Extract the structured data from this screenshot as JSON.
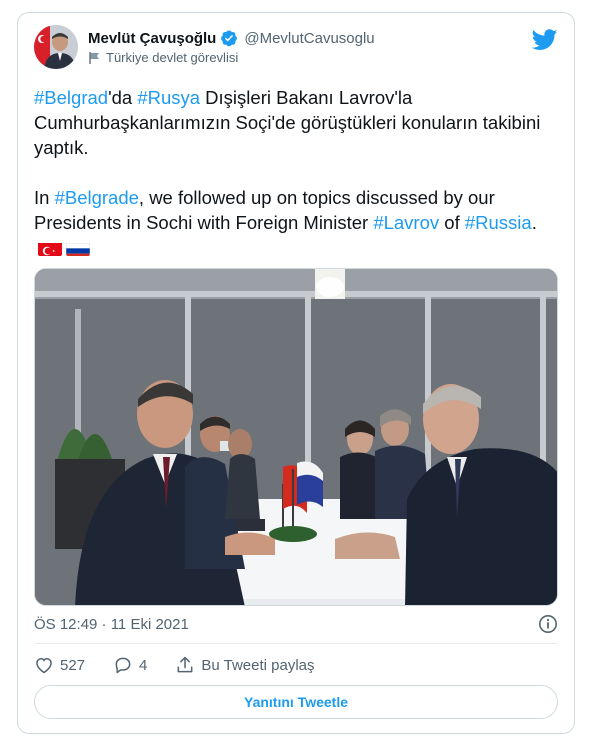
{
  "author": {
    "display_name": "Mevlüt Çavuşoğlu",
    "handle": "@MevlutCavusoglu",
    "label": "Türkiye devlet görevlisi",
    "verified": true
  },
  "tweet": {
    "tr_hashtag_1": "#Belgrad",
    "tr_text_1": "'da ",
    "tr_hashtag_2": "#Rusya",
    "tr_text_2": " Dışişleri Bakanı Lavrov'la Cumhurbaşkanlarımızın Soçi'de görüştükleri konuların takibini yaptık.",
    "en_text_1": "In ",
    "en_hashtag_1": "#Belgrade",
    "en_text_2": ", we followed up on topics discussed by our Presidents in Sochi with Foreign Minister ",
    "en_hashtag_2": "#Lavrov",
    "en_text_3": " of ",
    "en_hashtag_3": "#Russia",
    "en_text_4": ".",
    "flags": [
      "turkey-flag",
      "russia-flag"
    ]
  },
  "meta": {
    "timestamp": "ÖS 12:49 · 11 Eki 2021"
  },
  "actions": {
    "likes": "527",
    "replies": "4",
    "share_label": "Bu Tweeti paylaş"
  },
  "reply_button": {
    "label": "Yanıtını Tweetle"
  },
  "colors": {
    "accent": "#1d9bf0",
    "text": "#0f1419",
    "secondary": "#536471",
    "border": "#cfd9de"
  },
  "icons": {
    "brand": "twitter-bird-icon",
    "verified": "verified-badge-icon",
    "label": "flag-icon",
    "info": "info-icon",
    "like": "heart-icon",
    "reply": "reply-icon",
    "share": "share-icon"
  }
}
